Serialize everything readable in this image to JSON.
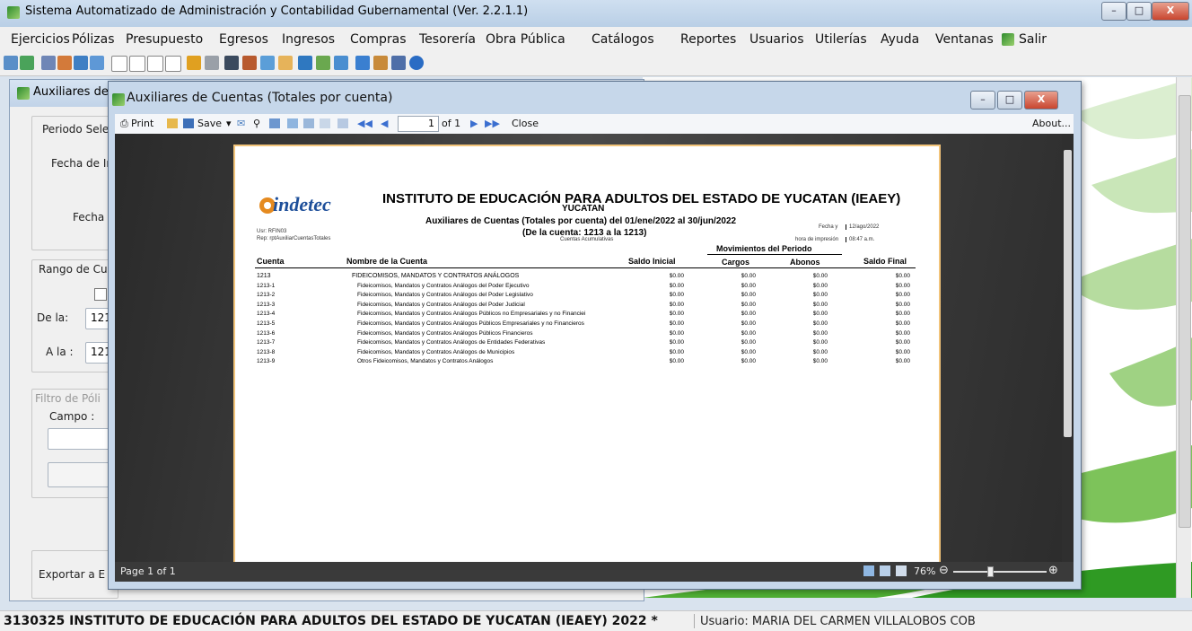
{
  "window": {
    "title": "Sistema Automatizado de Administración y Contabilidad Gubernamental  (Ver. 2.2.1.1)"
  },
  "menu": [
    "Ejercicios",
    "Pólizas",
    "Presupuesto",
    "Egresos",
    "Ingresos",
    "Compras",
    "Tesorería",
    "Obra Pública",
    "Catálogos",
    "Reportes",
    "Usuarios",
    "Utilerías",
    "Ayuda",
    "Ventanas",
    "Salir"
  ],
  "bgform": {
    "title": "Auxiliares de",
    "periodo_label": "Periodo Sele",
    "fecha_ini_label": "Fecha de In",
    "fecha_fin_label": "Fecha F",
    "rango_label": "Rango de Cu",
    "de_la_label": "De la:",
    "de_la_value": "121",
    "a_la_label": "A la :",
    "a_la_value": "121",
    "filtro_label": "Filtro de Póli",
    "campo_label": "Campo :",
    "exportar_label": "Exportar a E"
  },
  "preview": {
    "title": "Auxiliares de Cuentas (Totales por cuenta)",
    "toolbar": {
      "print": "Print",
      "save": "Save",
      "page_input": "1",
      "of_pages": "of 1",
      "close": "Close",
      "about": "About..."
    },
    "status_page": "Page 1 of 1",
    "zoom": "76%"
  },
  "report": {
    "logo": "indetec",
    "institution": "INSTITUTO DE EDUCACIÓN PARA ADULTOS DEL ESTADO DE YUCATAN (IEAEY)",
    "state": "YUCATAN",
    "subtitle": "Auxiliares de Cuentas (Totales por cuenta) del 01/ene/2022 al 30/jun/2022",
    "range": "(De la cuenta: 1213 a la 1213)",
    "kind": "Cuentas Acumulativas",
    "usr": "Usr: RFIN03",
    "rep": "Rep: rptAuxiliarCuentasTotales",
    "fecha_label": "Fecha y",
    "fecha_value": "12/ago/2022",
    "hora_label": "hora de impresión",
    "hora_value": "08:47 a.m.",
    "group_header": "Movimientos del Periodo",
    "columns": [
      "Cuenta",
      "Nombre de la Cuenta",
      "Saldo Inicial",
      "Cargos",
      "Abonos",
      "Saldo Final"
    ],
    "rows": [
      [
        "1213",
        "FIDEICOMISOS, MANDATOS Y CONTRATOS ANÁLOGOS",
        "$0.00",
        "$0.00",
        "$0.00",
        "$0.00"
      ],
      [
        "1213-1",
        "Fideicomisos, Mandatos y Contratos Análogos del Poder Ejecutivo",
        "$0.00",
        "$0.00",
        "$0.00",
        "$0.00"
      ],
      [
        "1213-2",
        "Fideicomisos, Mandatos y Contratos Análogos del Poder Legislativo",
        "$0.00",
        "$0.00",
        "$0.00",
        "$0.00"
      ],
      [
        "1213-3",
        "Fideicomisos, Mandatos y Contratos Análogos del Poder Judicial",
        "$0.00",
        "$0.00",
        "$0.00",
        "$0.00"
      ],
      [
        "1213-4",
        "Fideicomisos, Mandatos y Contratos Análogos Públicos no Empresariales y no Financiei",
        "$0.00",
        "$0.00",
        "$0.00",
        "$0.00"
      ],
      [
        "1213-5",
        "Fideicomisos, Mandatos y Contratos Análogos Públicos Empresariales y no Financieros",
        "$0.00",
        "$0.00",
        "$0.00",
        "$0.00"
      ],
      [
        "1213-6",
        "Fideicomisos, Mandatos y Contratos Análogos Públicos Financieros",
        "$0.00",
        "$0.00",
        "$0.00",
        "$0.00"
      ],
      [
        "1213-7",
        "Fideicomisos, Mandatos y Contratos Análogos de Entidades Federativas",
        "$0.00",
        "$0.00",
        "$0.00",
        "$0.00"
      ],
      [
        "1213-8",
        "Fideicomisos, Mandatos y Contratos Análogos de Municipios",
        "$0.00",
        "$0.00",
        "$0.00",
        "$0.00"
      ],
      [
        "1213-9",
        "Otros Fideicomisos, Mandatos y Contratos Análogos",
        "$0.00",
        "$0.00",
        "$0.00",
        "$0.00"
      ]
    ]
  },
  "statusbar": {
    "entity": "3130325 INSTITUTO DE EDUCACIÓN PARA ADULTOS DEL ESTADO DE YUCATAN (IEAEY)  2022   *",
    "user": "Usuario: MARIA DEL CARMEN VILLALOBOS COB"
  },
  "colors": {
    "accent_green": "#2e8b2e",
    "paper_border": "#f2c47a",
    "viewer_bg": "#3c3c3c"
  }
}
